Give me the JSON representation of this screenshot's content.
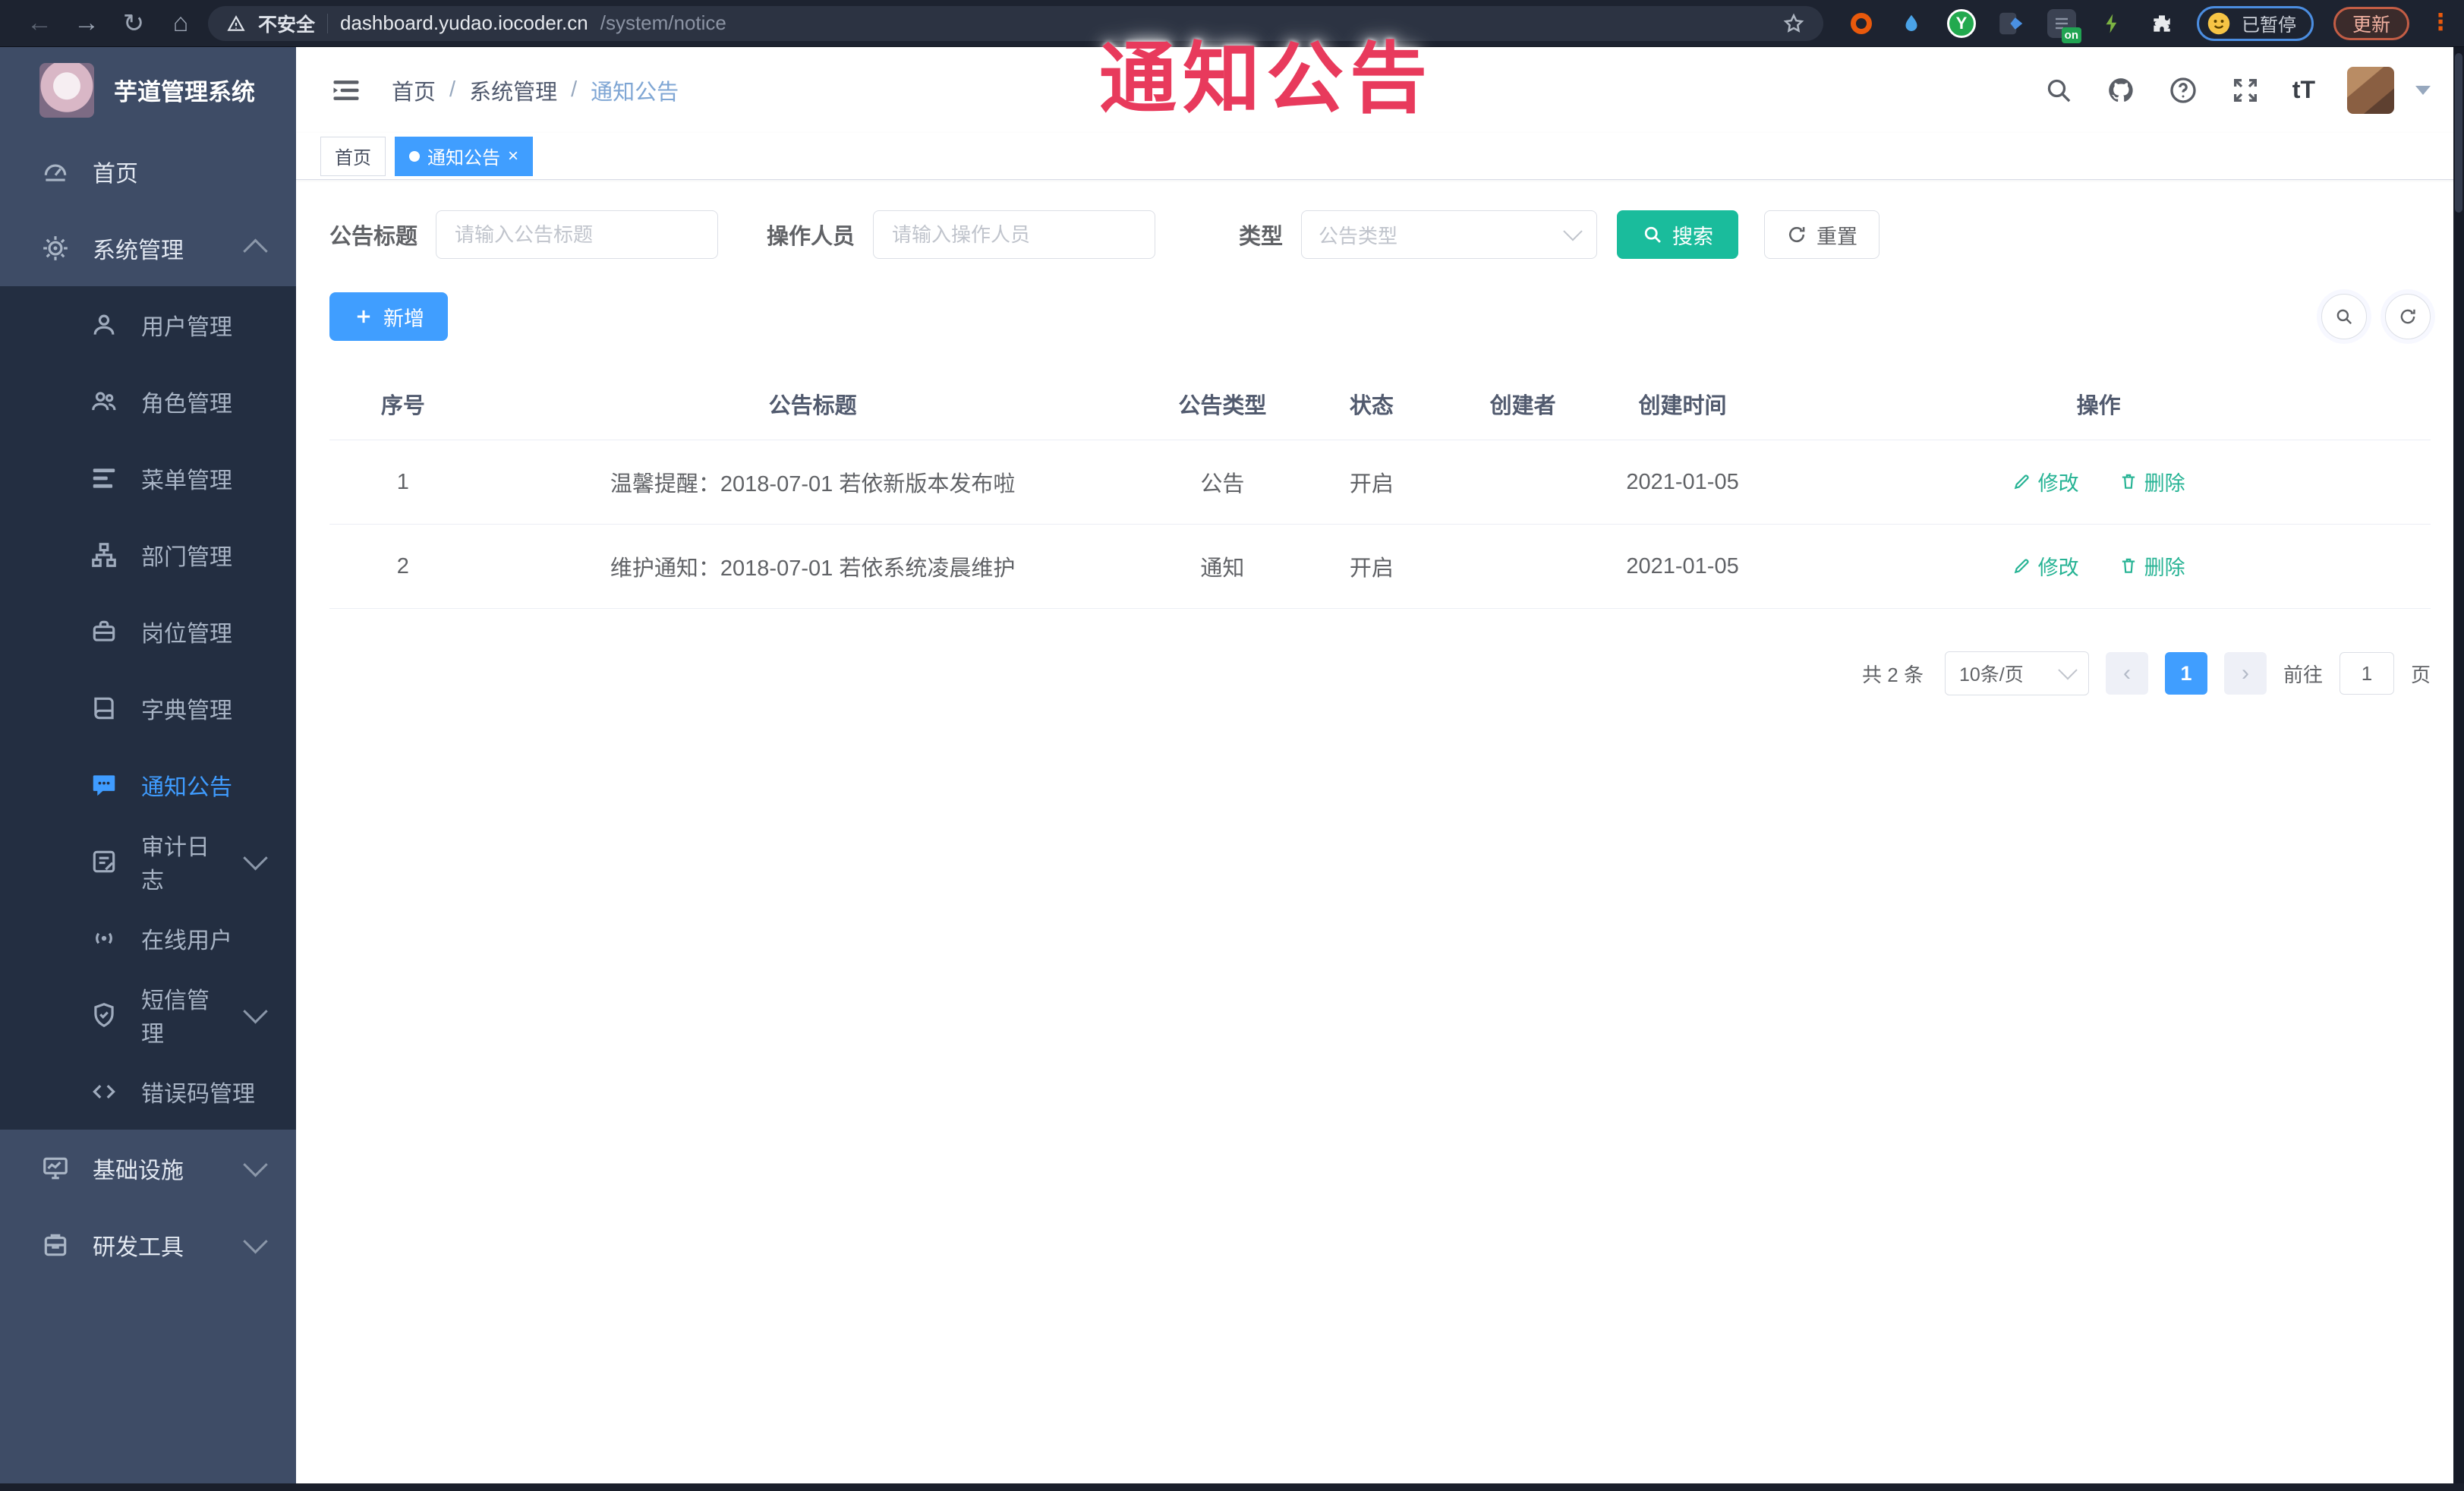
{
  "browser": {
    "security_label": "不安全",
    "url_host": "dashboard.yudao.iocoder.cn",
    "url_path": "/system/notice",
    "ext_letter": "Y",
    "ext_badge": "on",
    "profile_status": "已暂停",
    "update_label": "更新"
  },
  "sidebar": {
    "app_title": "芋道管理系统",
    "home": "首页",
    "system": "系统管理",
    "submenu": [
      {
        "label": "用户管理"
      },
      {
        "label": "角色管理"
      },
      {
        "label": "菜单管理"
      },
      {
        "label": "部门管理"
      },
      {
        "label": "岗位管理"
      },
      {
        "label": "字典管理"
      },
      {
        "label": "通知公告"
      },
      {
        "label": "审计日志"
      },
      {
        "label": "在线用户"
      },
      {
        "label": "短信管理"
      },
      {
        "label": "错误码管理"
      }
    ],
    "infra": "基础设施",
    "devtools": "研发工具"
  },
  "header": {
    "breadcrumb": [
      "首页",
      "系统管理",
      "通知公告"
    ],
    "font_size_icon": "tT",
    "tags": [
      {
        "label": "首页"
      },
      {
        "label": "通知公告"
      }
    ]
  },
  "watermark": "通知公告",
  "filters": {
    "title_label": "公告标题",
    "title_placeholder": "请输入公告标题",
    "operator_label": "操作人员",
    "operator_placeholder": "请输入操作人员",
    "type_label": "类型",
    "type_placeholder": "公告类型",
    "search_label": "搜索",
    "reset_label": "重置"
  },
  "toolbar": {
    "add_label": "新增"
  },
  "table": {
    "columns": [
      "序号",
      "公告标题",
      "公告类型",
      "状态",
      "创建者",
      "创建时间",
      "操作"
    ],
    "rows": [
      {
        "no": "1",
        "title": "温馨提醒：2018-07-01 若依新版本发布啦",
        "type": "公告",
        "status": "开启",
        "creator": "",
        "created": "2021-01-05"
      },
      {
        "no": "2",
        "title": "维护通知：2018-07-01 若依系统凌晨维护",
        "type": "通知",
        "status": "开启",
        "creator": "",
        "created": "2021-01-05"
      }
    ],
    "edit_label": "修改",
    "delete_label": "删除"
  },
  "pagination": {
    "total": "共 2 条",
    "page_size": "10条/页",
    "current_page": "1",
    "goto_label": "前往",
    "goto_value": "1",
    "unit_label": "页"
  },
  "colors": {
    "primary": "#409EFF",
    "search_button": "#1abc9c",
    "action_link": "#26b394",
    "watermark": "#e83a5c",
    "sidebar_bg": "#3e4c66",
    "submenu_bg": "#232e41",
    "active_menu": "#3f9cff",
    "tag_active": "#409EFF"
  }
}
